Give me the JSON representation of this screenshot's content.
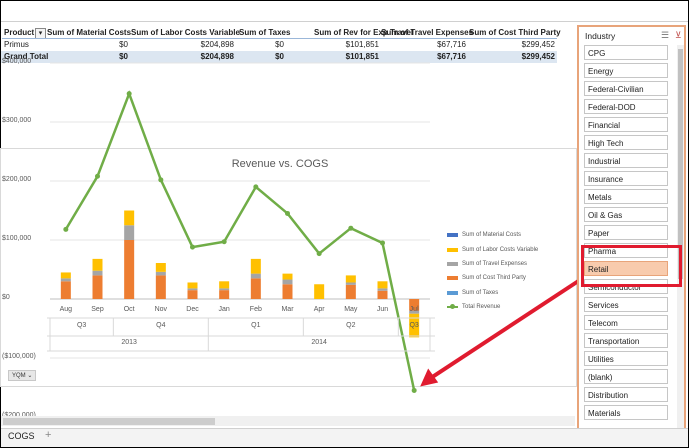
{
  "pivot": {
    "headers": [
      "Product",
      "Sum of Material Costs",
      "Sum of Labor Costs Variable",
      "Sum of Taxes",
      "Sum of Rev for Exp Travel",
      "Sum of Travel Expenses",
      "Sum of Cost Third Party"
    ],
    "rows": [
      [
        "Primus",
        "$0",
        "$204,898",
        "$0",
        "$101,851",
        "$67,716",
        "$299,452"
      ]
    ],
    "total": [
      "Grand Total",
      "$0",
      "$204,898",
      "$0",
      "$101,851",
      "$67,716",
      "$299,452"
    ]
  },
  "chart_data": {
    "type": "bar",
    "title": "Revenue vs. COGS",
    "categories": [
      "Aug",
      "Sep",
      "Oct",
      "Nov",
      "Dec",
      "Jan",
      "Feb",
      "Mar",
      "Apr",
      "May",
      "Jun",
      "Jul"
    ],
    "quarters": [
      {
        "label": "Q3",
        "from": 0,
        "to": 1
      },
      {
        "label": "Q4",
        "from": 2,
        "to": 4
      },
      {
        "label": "Q1",
        "from": 5,
        "to": 7
      },
      {
        "label": "Q2",
        "from": 8,
        "to": 10
      },
      {
        "label": "Q3",
        "from": 11,
        "to": 11
      }
    ],
    "years": [
      {
        "label": "2013",
        "from": 0,
        "to": 4
      },
      {
        "label": "2014",
        "from": 5,
        "to": 11
      }
    ],
    "ylim": [
      -200000,
      400000
    ],
    "yticks": [
      400000,
      300000,
      200000,
      100000,
      0,
      -100000,
      -200000
    ],
    "ytick_labels": [
      "$400,000",
      "$300,000",
      "$200,000",
      "$100,000",
      "$0",
      "($100,000)",
      "($200,000)"
    ],
    "series": [
      {
        "name": "Sum of Material Costs",
        "color": "#4472c4",
        "values": [
          0,
          0,
          0,
          0,
          0,
          0,
          0,
          0,
          0,
          0,
          0,
          0
        ]
      },
      {
        "name": "Sum of Labor Costs Variable",
        "color": "#ffc000",
        "values": [
          10000,
          20000,
          25000,
          15000,
          10000,
          12000,
          25000,
          10000,
          25000,
          12000,
          12000,
          -40000
        ]
      },
      {
        "name": "Sum of Travel Expenses",
        "color": "#a5a5a5",
        "values": [
          5000,
          8000,
          25000,
          6000,
          3000,
          3000,
          8000,
          8000,
          0,
          4000,
          4000,
          -5000
        ]
      },
      {
        "name": "Sum of Cost Third Party",
        "color": "#ed7d31",
        "values": [
          30000,
          40000,
          100000,
          40000,
          15000,
          15000,
          35000,
          25000,
          0,
          24000,
          14000,
          -20000
        ]
      },
      {
        "name": "Sum of Taxes",
        "color": "#5b9bd5",
        "values": [
          0,
          0,
          0,
          0,
          0,
          0,
          0,
          0,
          0,
          0,
          0,
          0
        ]
      }
    ],
    "line": {
      "name": "Total Revenue",
      "color": "#70ad47",
      "values": [
        118000,
        208000,
        348000,
        202000,
        88000,
        97000,
        190000,
        145000,
        77000,
        120000,
        95000,
        -155000
      ]
    },
    "filter_button": "YQM"
  },
  "slicer": {
    "title": "Industry",
    "items": [
      "CPG",
      "Energy",
      "Federal-Civilian",
      "Federal-DOD",
      "Financial",
      "High Tech",
      "Industrial",
      "Insurance",
      "Metals",
      "Oil & Gas",
      "Paper",
      "Pharma",
      "Retail",
      "Semiconductor",
      "Services",
      "Telecom",
      "Transportation",
      "Utilities",
      "(blank)",
      "Distribution",
      "Materials"
    ],
    "selected": "Retail"
  },
  "sheet_tab": "COGS",
  "add_tab": "+",
  "colors": {
    "annotation": "#e01b2f"
  }
}
